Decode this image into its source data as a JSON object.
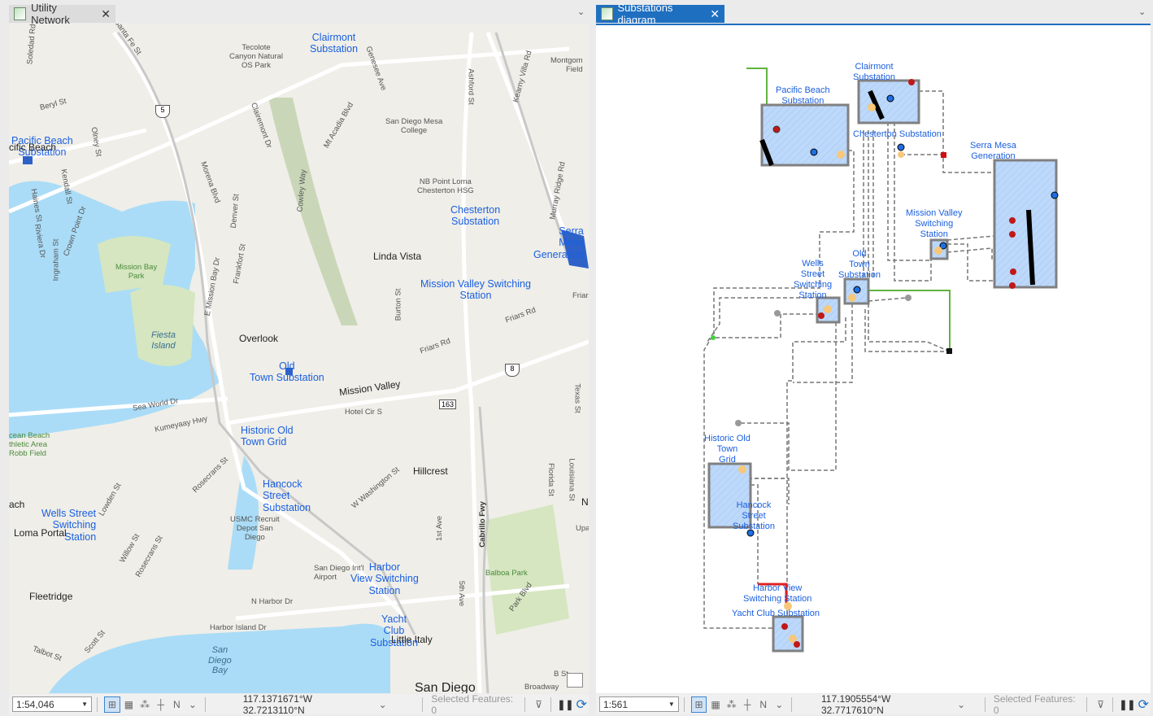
{
  "tabs": {
    "left": {
      "label": "Utility Network",
      "icon": "map-icon"
    },
    "right": {
      "label": "Substations diagram",
      "icon": "diagram-icon"
    }
  },
  "map": {
    "substations": [
      {
        "id": "clairmont",
        "text": "Clairmont\nSubstation"
      },
      {
        "id": "pacific-beach",
        "text": "Pacific Beach\nSubstation"
      },
      {
        "id": "chesterton",
        "text": "Chesterton\nSubstation"
      },
      {
        "id": "serra-mesa",
        "text": "Serra\nMesa\nGeneration"
      },
      {
        "id": "mission-valley",
        "text": "Mission Valley Switching\nStation"
      },
      {
        "id": "old-town",
        "text": "Old\nTown Substation"
      },
      {
        "id": "historic-old-town",
        "text": "Historic Old\nTown Grid"
      },
      {
        "id": "hancock",
        "text": "Hancock\nStreet\nSubstation"
      },
      {
        "id": "wells",
        "text": "Wells Street\nSwitching\nStation"
      },
      {
        "id": "harbor-view",
        "text": "Harbor\nView Switching\nStation"
      },
      {
        "id": "yacht-club",
        "text": "Yacht\nClub\nSubstation"
      }
    ],
    "places": [
      "Linda Vista",
      "Overlook",
      "Mission Valley",
      "Hillcrest",
      "Loma Portal",
      "Fleetridge",
      "Little Italy",
      "San Diego",
      "cific Beach",
      "ach"
    ],
    "pois": [
      "Tecolote\nCanyon Natural\nOS Park",
      "San Diego Mesa\nCollege",
      "NB Point Loma\nChesterton HSG",
      "Montgom\nField",
      "USMC Recruit\nDepot San\nDiego",
      "San Diego Int'l\nAirport"
    ],
    "parks": [
      "Mission Bay\nPark",
      "cean Beach\nthletic Area\nRobb Field",
      "Balboa Park"
    ],
    "water": [
      "Fiesta\nIsland",
      "San\nDiego\nBay"
    ],
    "streets": [
      "Beryl St",
      "Olney St",
      "Kendall St",
      "Haines St",
      "Riviera Dr",
      "Crown Point Dr",
      "Ingraham St",
      "Morena Blvd",
      "Denver St",
      "Clairemont Dr",
      "Cowley Way",
      "Mt Acadia Blvd",
      "Genesee Ave",
      "Ashford St",
      "Kearny Villa Rd",
      "Murray Ridge Rd",
      "E Mission Bay Dr",
      "Frankfort St",
      "Burton St",
      "Friars Rd",
      "Friars Rd",
      "Sea World Dr",
      "Kumeyaay Hwy",
      "Hotel Cir S",
      "Texas St",
      "Rosecrans St",
      "W Washington St",
      "Florida St",
      "Louisiana St",
      "1st Ave",
      "Cabrillo Fwy",
      "5th Ave",
      "Park Blvd",
      "N Harbor Dr",
      "Harbor Island Dr",
      "Willow St",
      "Rosecrans St",
      "Scott St",
      "Talbot St",
      "Lowden St",
      "Soledad Rd",
      "Santa Fe St",
      "Broadway",
      "Friars Rd",
      "Upa",
      "N",
      "B St"
    ],
    "shields": [
      "5",
      "8",
      "163"
    ]
  },
  "diagram": {
    "labels": [
      "Clairmont\nSubstation",
      "Pacific Beach\nSubstation",
      "Chesterton Substation",
      "Serra Mesa\nGeneration",
      "Mission Valley\nSwitching\nStation",
      "Old\nTown\nSubstation",
      "Wells\nStreet\nSwitching\nStation",
      "Historic Old\nTown\nGrid",
      "Hancock\nStreet\nSubstation",
      "Harbor View\nSwitching Station",
      "Yacht Club Substation"
    ]
  },
  "status_left": {
    "scale": "1:54,046",
    "coords": "117.1371671°W 32.7213110°N",
    "selected": "Selected Features: 0"
  },
  "status_right": {
    "scale": "1:561",
    "coords": "117.1905554°W 32.7717610°N",
    "selected": "Selected Features: 0"
  },
  "colors": {
    "accent": "#1f6fc1",
    "label": "#1a5fe0",
    "water": "#aadcf7",
    "land": "#efeee8",
    "park": "#d5e6c0",
    "box": "#bcd8fb"
  }
}
